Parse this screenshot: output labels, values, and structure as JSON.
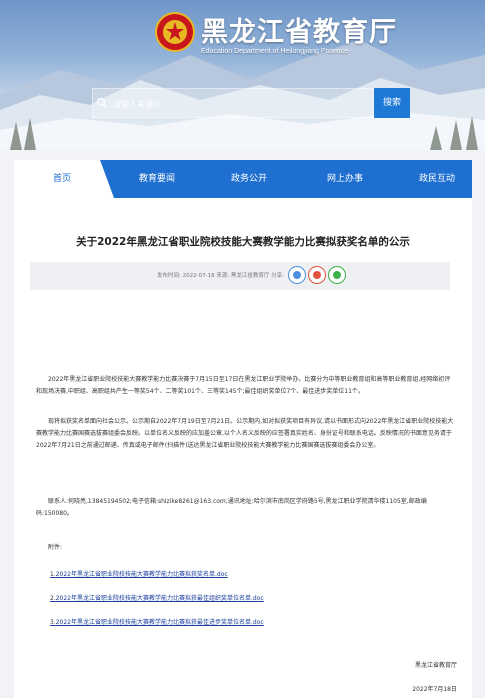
{
  "header": {
    "title_cn": "黑龙江省教育厅",
    "title_en": "Education Department of Heilongjiang Province",
    "search_placeholder": "请输入关键词",
    "search_button": "搜索"
  },
  "nav": [
    "首页",
    "教育要闻",
    "政务公开",
    "网上办事",
    "政民互动"
  ],
  "article": {
    "title": "关于2022年黑龙江省职业院校技能大赛教学能力比赛拟获奖名单的公示",
    "meta": "发布时间: 2022-07-18  来源: 黑龙江省教育厅  分享:",
    "share_icons": [
      "qq-icon",
      "weibo-icon",
      "wechat-icon"
    ],
    "paragraphs": [
      "2022年黑龙江省职业院校技能大赛教学能力比赛决赛于7月15日至17日在黑龙江职业学院举办。比赛分为中等职业教育组和高等职业教育组,经网络初评和现场决赛,中职组、高职组共产生一等奖54个、二等奖101个、三等奖145个;最佳组织奖单位7个、最佳进步奖单位11个。",
      "现将拟获奖名单面向社会公示。公示期自2022年7月19日至7月21日。公示期内,如对拟获奖项目有异议,请以书面形式向2022年黑龙江省职业院校技能大赛教学能力比赛国赛选拔赛组委会反映。以单位名义反映的应加盖公章,以个人名义反映的应签署真实姓名、身份证号和联系电话。反映情况的书面意见务请于2022年7月21日之前通过邮递、传真或电子邮件(扫描件)送达黑龙江省职业院校技能大赛教学能力比赛国赛选拔赛组委会办公室。",
      "联系人:何晓亮,13845194502;电子信箱:shizike8261@163.com;通讯地址:哈尔滨市南岗区学府路5号,黑龙江职业学院清华楼1105室,邮政编码:150080。"
    ],
    "attachments_label": "附件:",
    "attachments": [
      {
        "num": "1.",
        "name": "2022年黑龙江省职业院校技能大赛教学能力比赛拟获奖名单.doc"
      },
      {
        "num": "2.",
        "name": "2022年黑龙江省职业院校技能大赛教学能力比赛拟获最佳组织奖单位名单.doc"
      },
      {
        "num": "3.",
        "name": "2022年黑龙江省职业院校技能大赛教学能力比赛拟获最佳进步奖单位名单.doc"
      }
    ],
    "signature_org": "黑龙江省教育厅",
    "signature_date": "2022年7月18日"
  },
  "colors": {
    "nav_bg": "#1f6fd0",
    "link": "#1a3c9c",
    "search_button": "#1e78d5"
  }
}
